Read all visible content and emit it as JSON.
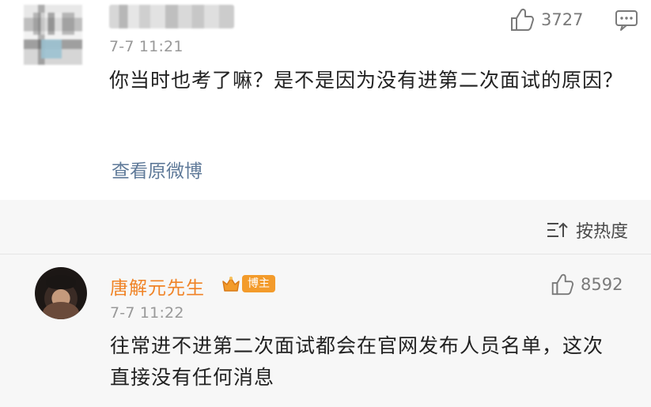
{
  "comment1": {
    "time": "7-7 11:21",
    "text": "你当时也考了嘛？是不是因为没有进第二次面试的原因？",
    "view_original": "查看原微博",
    "likes": "3727"
  },
  "sort": {
    "label": "按热度"
  },
  "comment2": {
    "username": "唐解元先生",
    "badge": "博主",
    "time": "7-7 11:22",
    "text": "往常进不进第二次面试都会在官网发布人员名单，这次直接没有任何消息",
    "likes": "8592"
  },
  "colors": {
    "username": "#f08326",
    "link": "#5f7a99",
    "time": "#999999",
    "badge": "#f39b2b"
  },
  "icons": {
    "like": "thumbs-up-icon",
    "comment": "comment-icon",
    "sort": "sort-icon",
    "badge": "crown-icon"
  }
}
